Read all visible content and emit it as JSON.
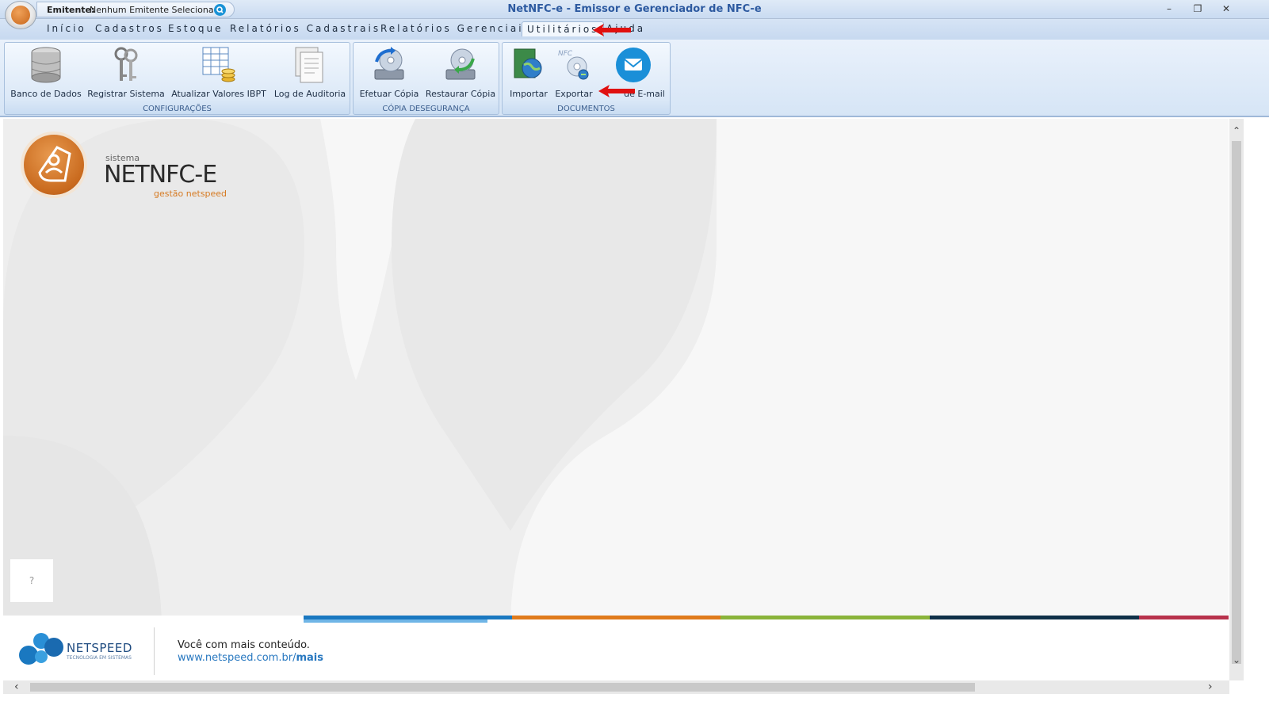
{
  "window": {
    "title": "NetNFC-e - Emissor e Gerenciador de NFC-e",
    "minimize": "–",
    "restore": "❐",
    "close": "✕"
  },
  "emitente": {
    "label": "Emitente:",
    "value": "Nenhum Emitente Selecionado"
  },
  "tabs": [
    {
      "label": "Início"
    },
    {
      "label": "Cadastros"
    },
    {
      "label": "Estoque"
    },
    {
      "label": "Relatórios Cadastrais"
    },
    {
      "label": "Relatórios Gerenciais"
    },
    {
      "label": "Utilitários",
      "active": true
    },
    {
      "label": "Ajuda"
    }
  ],
  "ribbon": {
    "configuracoes": {
      "label": "CONFIGURAÇÕES",
      "buttons": {
        "banco": "Banco de Dados",
        "registrar": "Registrar Sistema",
        "ibpt": "Atualizar Valores IBPT",
        "log": "Log de Auditoria"
      }
    },
    "copia": {
      "label": "CÓPIA DESEGURANÇA",
      "buttons": {
        "efetuar": "Efetuar Cópia",
        "restaurar": "Restaurar Cópia"
      }
    },
    "documentos": {
      "label": "DOCUMENTOS",
      "buttons": {
        "importar": "Importar",
        "exportar": "Exportar",
        "email": "de E-mail"
      }
    }
  },
  "logo": {
    "sistema": "sistema",
    "name": "NETNFC-E",
    "sub": "gestão netspeed"
  },
  "help": "?",
  "footer": {
    "brand": "NETSPEED",
    "tagline": "TECNOLOGIA EM SISTEMAS",
    "line1": "Você com mais conteúdo.",
    "url_prefix": "www.netspeed.com.br/",
    "url_bold": "mais",
    "stripe_colors": [
      "#1a78c0",
      "#e07b1c",
      "#8ab43a",
      "#0f3048",
      "#b8324c"
    ]
  },
  "colors": {
    "accent": "#2d5aa0",
    "annotation_arrow": "#e01010"
  }
}
